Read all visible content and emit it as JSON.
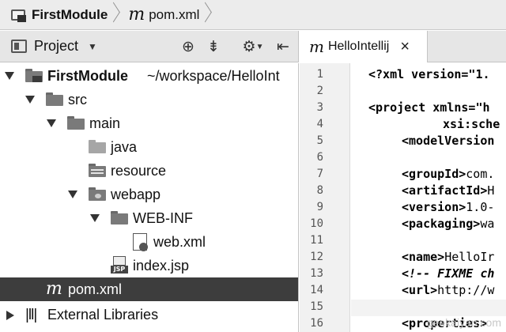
{
  "breadcrumb": {
    "module": "FirstModule",
    "file": "pom.xml"
  },
  "project_panel": {
    "title": "Project"
  },
  "tree": {
    "items": [
      {
        "label": "FirstModule",
        "path": "~/workspace/HelloInt"
      },
      {
        "label": "src"
      },
      {
        "label": "main"
      },
      {
        "label": "java"
      },
      {
        "label": "resource"
      },
      {
        "label": "webapp"
      },
      {
        "label": "WEB-INF"
      },
      {
        "label": "web.xml"
      },
      {
        "label": "index.jsp"
      },
      {
        "label": "pom.xml"
      },
      {
        "label": "External Libraries"
      }
    ]
  },
  "editor": {
    "tab_label": "HelloIntellij",
    "line_numbers": [
      "1",
      "2",
      "3",
      "4",
      "5",
      "6",
      "7",
      "8",
      "9",
      "10",
      "11",
      "12",
      "13",
      "14",
      "15",
      "16"
    ],
    "lines": {
      "l1": "<?xml version=\"1.",
      "l3_tag": "<project",
      "l3_rest": " xmlns=\"h",
      "l4": "xsi:sche",
      "l5": "<modelVersion",
      "l7_tag": "<groupId>",
      "l7_rest": "com.",
      "l8_tag": "<artifactId>",
      "l8_rest": "H",
      "l9_tag": "<version>",
      "l9_rest": "1.0-",
      "l10_tag": "<packaging>",
      "l10_rest": "wa",
      "l12_tag": "<name>",
      "l12_rest": "HelloIr",
      "l13": "<!-- FIXME ch",
      "l14_tag": "<url>",
      "l14_rest": "http://w",
      "l16": "<properties>"
    }
  },
  "watermark": "geekaiyan.com"
}
